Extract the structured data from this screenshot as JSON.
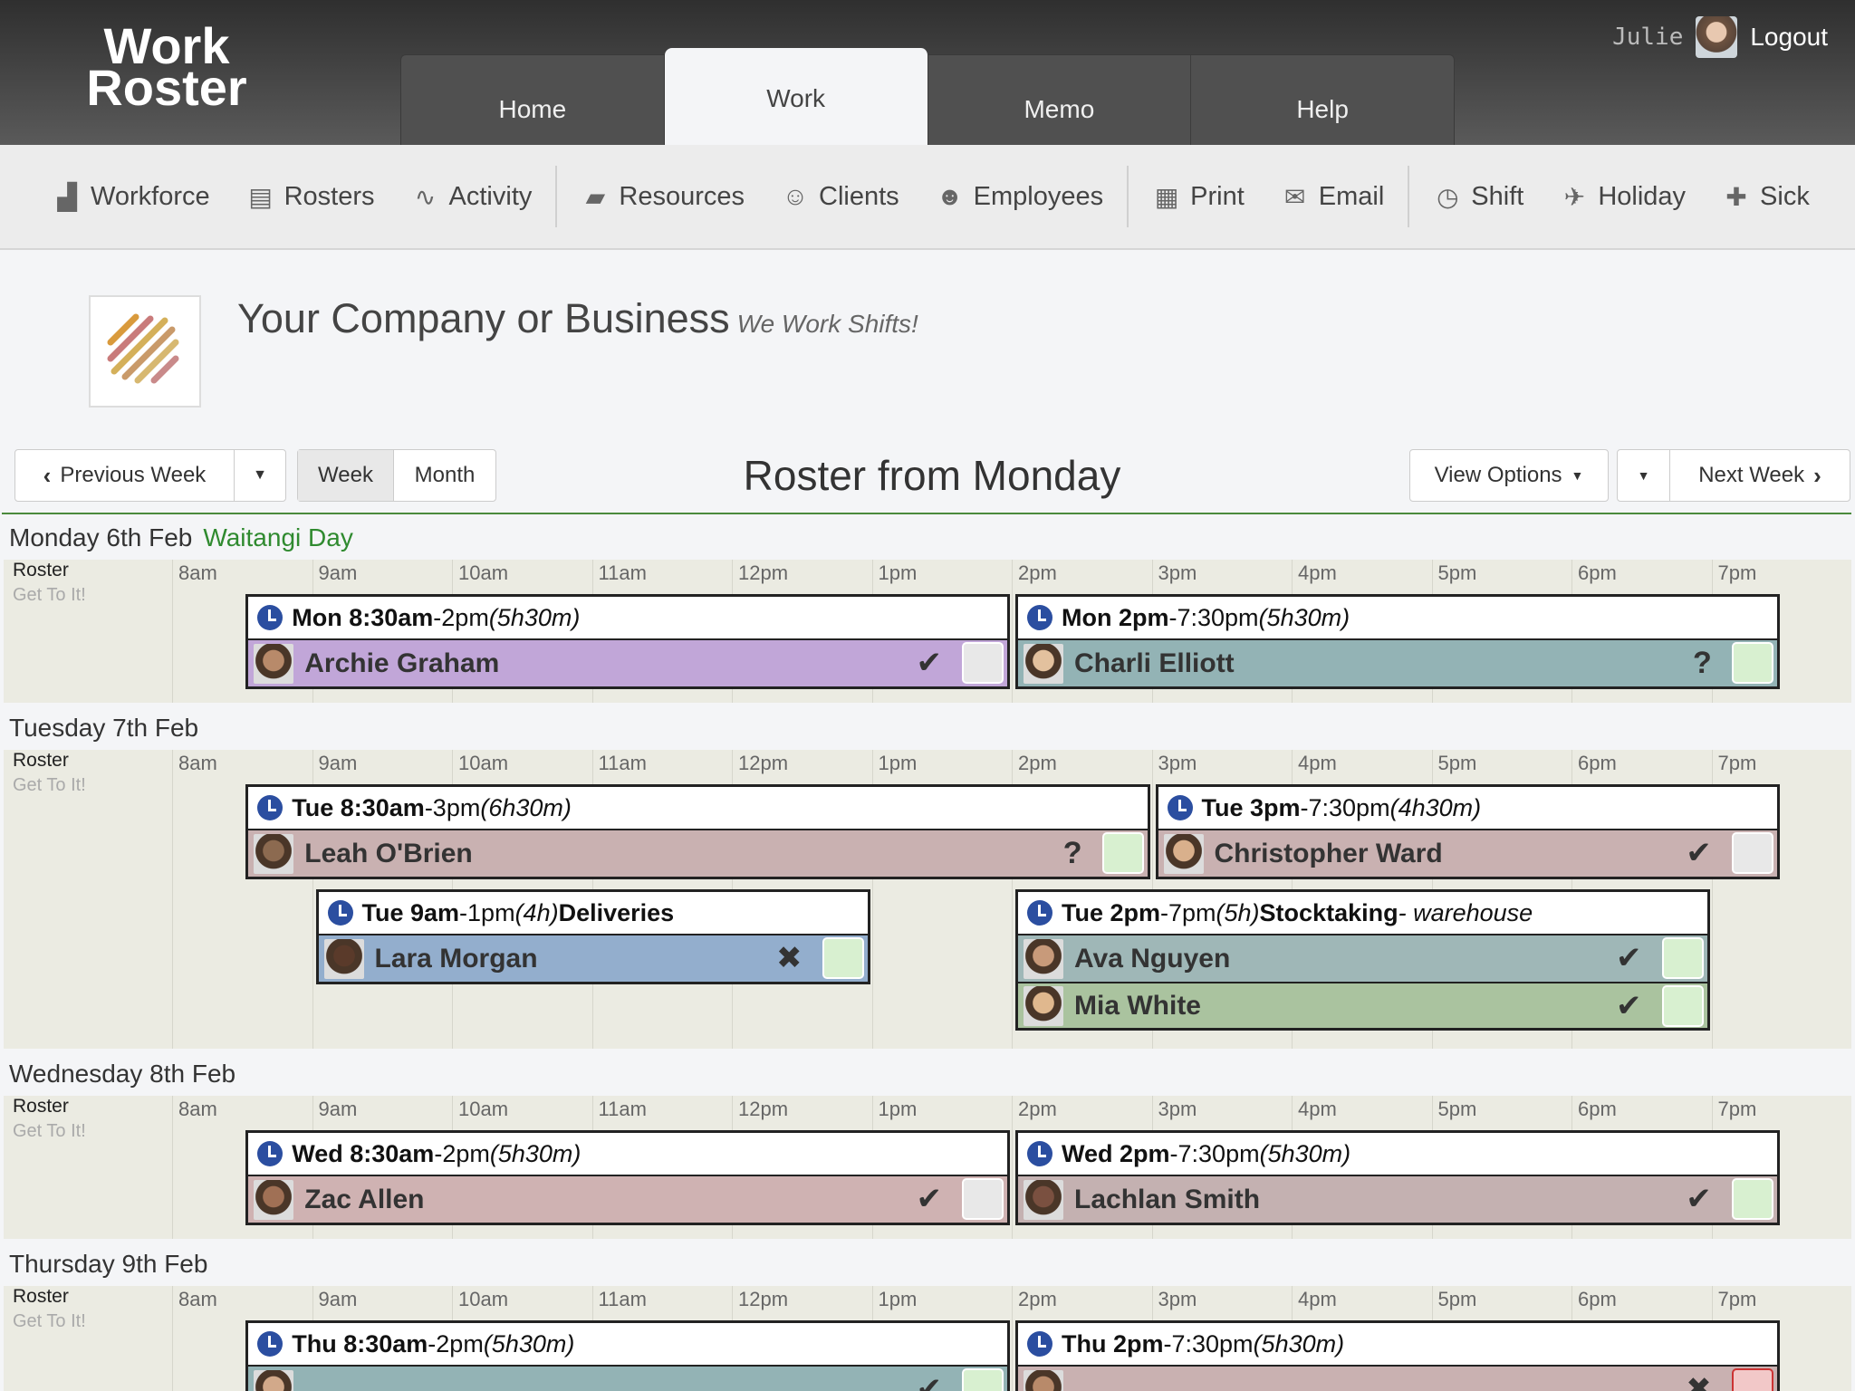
{
  "app": {
    "logo_line1": "Work",
    "logo_line2": "Roster"
  },
  "tabs": [
    {
      "label": "Home"
    },
    {
      "label": "Work",
      "active": true
    },
    {
      "label": "Memo"
    },
    {
      "label": "Help"
    }
  ],
  "user": {
    "name": "Julie",
    "logout": "Logout"
  },
  "toolbar": {
    "groups": [
      [
        {
          "label": "Workforce",
          "icon": "factory-icon"
        },
        {
          "label": "Rosters",
          "icon": "clipboard-icon"
        },
        {
          "label": "Activity",
          "icon": "pulse-icon"
        }
      ],
      [
        {
          "label": "Resources",
          "icon": "truck-icon"
        },
        {
          "label": "Clients",
          "icon": "client-icon"
        },
        {
          "label": "Employees",
          "icon": "user-icon"
        }
      ],
      [
        {
          "label": "Print",
          "icon": "printer-icon"
        },
        {
          "label": "Email",
          "icon": "envelope-icon"
        }
      ],
      [
        {
          "label": "Shift",
          "icon": "clock-icon"
        },
        {
          "label": "Holiday",
          "icon": "plane-icon"
        },
        {
          "label": "Sick",
          "icon": "medkit-icon"
        }
      ]
    ]
  },
  "company": {
    "name": "Your Company or Business",
    "tagline": "We Work Shifts!"
  },
  "nav": {
    "prev": "Previous Week",
    "week": "Week",
    "month": "Month",
    "title": "Roster from Monday",
    "view_options": "View Options",
    "next": "Next Week"
  },
  "hours": [
    "8am",
    "9am",
    "10am",
    "11am",
    "12pm",
    "1pm",
    "2pm",
    "3pm",
    "4pm",
    "5pm",
    "6pm",
    "7pm"
  ],
  "row_label": {
    "roster": "Roster",
    "sub": "Get To It!"
  },
  "colors": {
    "accent": "#4b8a3c",
    "clock": "#2b4ea0",
    "check_on": "#d8f0d0",
    "check_off": "#e8e8e8",
    "check_red": "#f2c8c8"
  },
  "days": [
    {
      "label": "Monday 6th Feb",
      "holiday": "Waitangi Day",
      "band_height": 158,
      "shifts": [
        {
          "start": 8.5,
          "end": 14,
          "row": 0,
          "head_bold": "Mon 8:30am",
          "head_rest": "-2pm ",
          "dur": "(5h30m)",
          "extra": "",
          "note": "",
          "people": [
            {
              "name": "Archie Graham",
              "color": "#c1a6d8",
              "status": "check",
              "box": "off"
            }
          ]
        },
        {
          "start": 14,
          "end": 19.5,
          "row": 0,
          "head_bold": "Mon 2pm",
          "head_rest": "-7:30pm ",
          "dur": "(5h30m)",
          "extra": "",
          "note": "",
          "people": [
            {
              "name": "Charli Elliott",
              "color": "#93b3b5",
              "status": "question",
              "box": "on"
            }
          ]
        }
      ]
    },
    {
      "label": "Tuesday 7th Feb",
      "holiday": "",
      "band_height": 330,
      "shifts": [
        {
          "start": 8.5,
          "end": 15,
          "row": 0,
          "head_bold": "Tue 8:30am",
          "head_rest": "-3pm ",
          "dur": "(6h30m)",
          "extra": "",
          "note": "",
          "people": [
            {
              "name": "Leah O'Brien",
              "color": "#c9b1b1",
              "status": "question",
              "box": "on"
            }
          ]
        },
        {
          "start": 15,
          "end": 19.5,
          "row": 0,
          "head_bold": "Tue 3pm",
          "head_rest": "-7:30pm ",
          "dur": "(4h30m)",
          "extra": "",
          "note": "",
          "people": [
            {
              "name": "Christopher Ward",
              "color": "#c9b1b1",
              "status": "check",
              "box": "off"
            }
          ]
        },
        {
          "start": 9,
          "end": 13,
          "row": 1,
          "head_bold": "Tue 9am",
          "head_rest": "-1pm ",
          "dur": "(4h)",
          "extra": " Deliveries",
          "note": "",
          "people": [
            {
              "name": "Lara Morgan",
              "color": "#93aecd",
              "status": "cross",
              "box": "on"
            }
          ]
        },
        {
          "start": 14,
          "end": 19,
          "row": 1,
          "head_bold": "Tue 2pm",
          "head_rest": "-7pm ",
          "dur": "(5h)",
          "extra": " Stocktaking",
          "note": " - warehouse",
          "people": [
            {
              "name": "Ava Nguyen",
              "color": "#9fb7b7",
              "status": "check",
              "box": "on"
            },
            {
              "name": "Mia White",
              "color": "#aac39f",
              "status": "check",
              "box": "on"
            }
          ]
        }
      ]
    },
    {
      "label": "Wednesday 8th Feb",
      "holiday": "",
      "band_height": 158,
      "shifts": [
        {
          "start": 8.5,
          "end": 14,
          "row": 0,
          "head_bold": "Wed 8:30am",
          "head_rest": "-2pm ",
          "dur": "(5h30m)",
          "extra": "",
          "note": "",
          "people": [
            {
              "name": "Zac Allen",
              "color": "#cfb2b2",
              "status": "check",
              "box": "off"
            }
          ]
        },
        {
          "start": 14,
          "end": 19.5,
          "row": 0,
          "head_bold": "Wed 2pm",
          "head_rest": "-7:30pm ",
          "dur": "(5h30m)",
          "extra": "",
          "note": "",
          "people": [
            {
              "name": "Lachlan Smith",
              "color": "#c4b1b1",
              "status": "check",
              "box": "on"
            }
          ]
        }
      ]
    },
    {
      "label": "Thursday 9th Feb",
      "holiday": "",
      "band_height": 158,
      "shifts": [
        {
          "start": 8.5,
          "end": 14,
          "row": 0,
          "head_bold": "Thu 8:30am",
          "head_rest": "-2pm ",
          "dur": "(5h30m)",
          "extra": "",
          "note": "",
          "people": [
            {
              "name": "",
              "color": "#93b3b5",
              "status": "check",
              "box": "on"
            }
          ]
        },
        {
          "start": 14,
          "end": 19.5,
          "row": 0,
          "head_bold": "Thu 2pm",
          "head_rest": "-7:30pm ",
          "dur": "(5h30m)",
          "extra": "",
          "note": "",
          "people": [
            {
              "name": "",
              "color": "#c9b1b1",
              "status": "cross",
              "box": "red"
            }
          ]
        }
      ]
    }
  ]
}
